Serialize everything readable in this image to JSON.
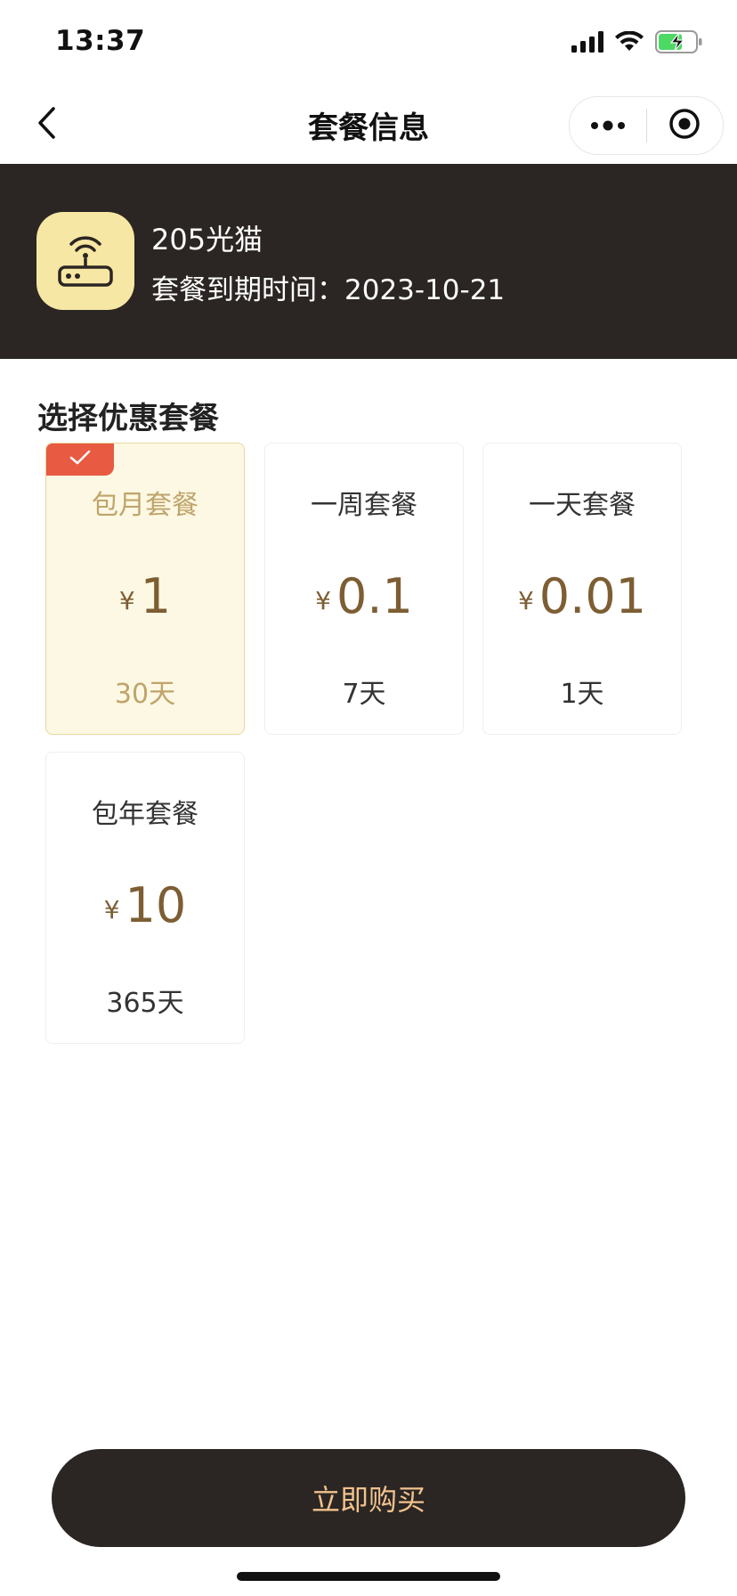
{
  "status_bar": {
    "time": "13:37",
    "icons": [
      "signal-icon",
      "wifi-icon",
      "battery-charging-icon"
    ],
    "battery_color": "#4cd964"
  },
  "nav": {
    "title": "套餐信息",
    "back_icon": "chevron-left-icon",
    "more_icon": "more-dots-icon",
    "close_icon": "target-icon"
  },
  "device": {
    "icon": "router-wifi-icon",
    "icon_bg": "#f7e7a4",
    "name": "205光猫",
    "expiry": "套餐到期时间：2023-10-21"
  },
  "section_title": "选择优惠套餐",
  "packages": [
    {
      "name": "包月套餐",
      "currency": "¥",
      "price": "1",
      "days": "30天",
      "selected": true
    },
    {
      "name": "一周套餐",
      "currency": "¥",
      "price": "0.1",
      "days": "7天",
      "selected": false
    },
    {
      "name": "一天套餐",
      "currency": "¥",
      "price": "0.01",
      "days": "1天",
      "selected": false
    },
    {
      "name": "包年套餐",
      "currency": "¥",
      "price": "10",
      "days": "365天",
      "selected": false
    }
  ],
  "buy_button": {
    "label": "立即购买"
  },
  "colors": {
    "header_bg": "#2b2623",
    "price": "#7d5e33",
    "selected_bg": "#fdf8e3",
    "badge": "#e85a42",
    "button_text": "#f1c28e"
  }
}
